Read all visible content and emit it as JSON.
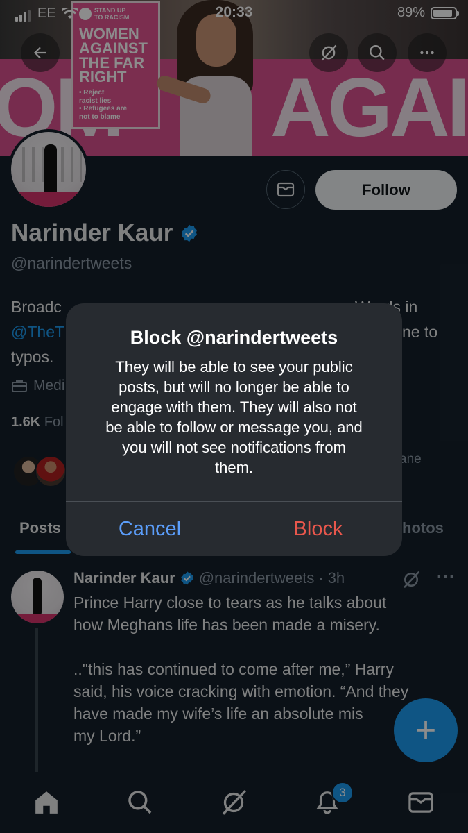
{
  "status_bar": {
    "carrier": "EE",
    "time": "20:33",
    "battery": "89%",
    "battery_level": 0.89
  },
  "banner": {
    "placard_logo_line1": "STAND UP",
    "placard_logo_line2": "TO RACISM",
    "placard_headline_1": "WOMEN",
    "placard_headline_2": "AGAINST",
    "placard_headline_3": "THE FAR",
    "placard_headline_4": "RIGHT",
    "placard_sub_1": "• Reject",
    "placard_sub_2": "racist lies",
    "placard_sub_3": "• Refugees are",
    "placard_sub_4": "not to blame",
    "banner_text_left": "OM",
    "banner_text_right": "AGAI"
  },
  "profile": {
    "follow_label": "Follow",
    "name": "Narinder Kaur",
    "handle": "@narindertweets",
    "bio_line1": "Broadc",
    "bio_line1_right": "Words in",
    "bio_line2_link": "@TheT",
    "bio_line2_right": "ne to",
    "bio_line3": "typos.",
    "meta": "Medi",
    "stats_count": "1.6K",
    "stats_label": "Fol",
    "followers_tail": "ane"
  },
  "tabs": [
    {
      "label": "Posts"
    },
    {
      "label": "hotos"
    }
  ],
  "tweet": {
    "name": "Narinder Kaur",
    "handle": "@narindertweets",
    "separator": "·",
    "time": "3h",
    "more": "···",
    "line1": "Prince Harry close to tears as he talks about",
    "line2": "how Meghans life has been made a misery.",
    "line3": "..\"this has continued to come after me,” Harry",
    "line4": "said, his voice cracking with emotion. “And they",
    "line5": "have made my wife’s life an absolute mis",
    "line6": "my Lord.”"
  },
  "fab": {
    "label": "+"
  },
  "bottom_nav": {
    "notifications_badge": "3"
  },
  "dialog": {
    "title": "Block @narindertweets",
    "message_lines": [
      "They will be able to see your public",
      "posts, but will no longer be able to",
      "engage with them. They will also not",
      "be able to follow or message you, and",
      "you will not see notifications from",
      "them."
    ],
    "cancel_label": "Cancel",
    "block_label": "Block"
  },
  "colors": {
    "background": "#15202b",
    "accent": "#1d9bf0",
    "dialog_bg": "#272b30",
    "cancel": "#5b9df9",
    "block": "#e8574c"
  }
}
